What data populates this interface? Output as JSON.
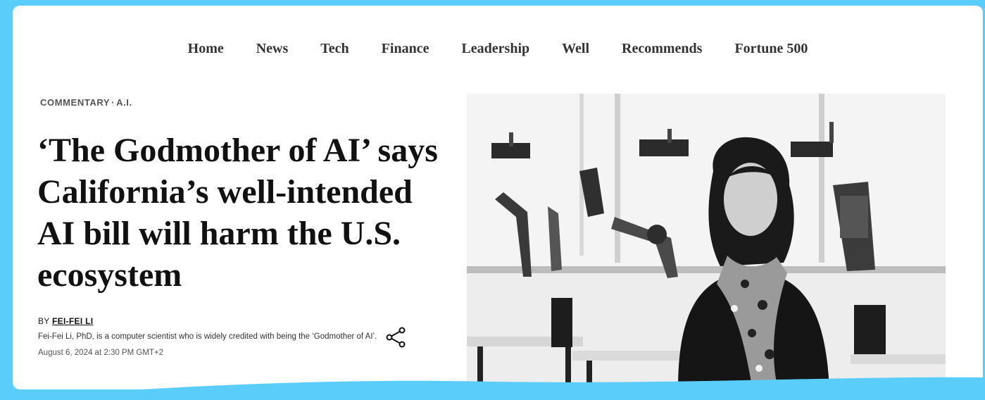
{
  "nav": {
    "items": [
      "Home",
      "News",
      "Tech",
      "Finance",
      "Leadership",
      "Well",
      "Recommends",
      "Fortune 500"
    ]
  },
  "article": {
    "kicker_section": "COMMENTARY",
    "kicker_separator": "·",
    "kicker_topic": "A.I.",
    "headline": "‘The Godmother of AI’ says California’s well-intended AI bill will harm the U.S. ecosystem",
    "byline_prefix": "BY",
    "author": "FEI-FEI LI",
    "author_bio": "Fei-Fei Li, PhD, is a computer scientist who is widely credited with being the ‘Godmother of AI’.",
    "date": "August 6, 2024 at 2:30 PM GMT+2"
  },
  "icons": {
    "share": "share-icon"
  },
  "colors": {
    "frame": "#5bcdfb",
    "background": "#ffffff",
    "text": "#111111"
  }
}
